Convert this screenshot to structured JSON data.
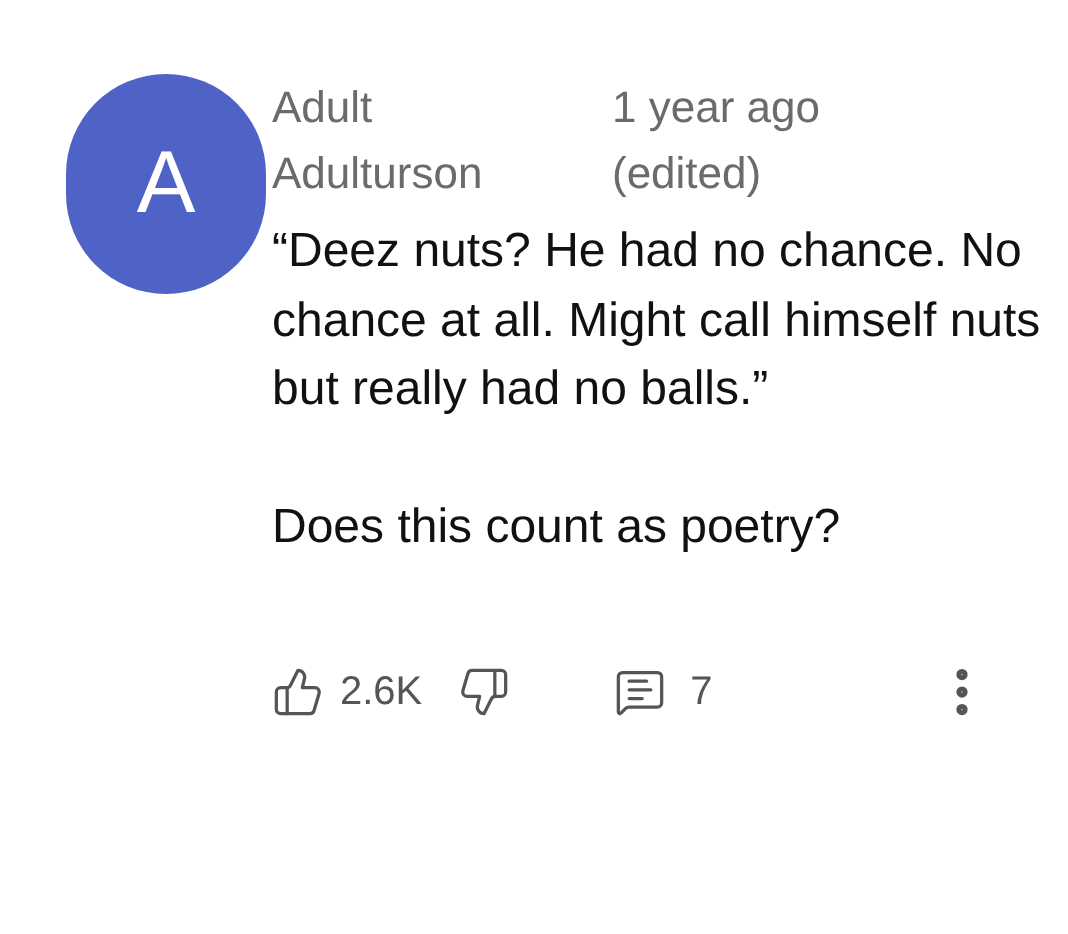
{
  "comment": {
    "avatar_letter": "A",
    "author": "Adult Adulturson",
    "time": "1 year ago (edited)",
    "paragraphs": [
      "“Deez nuts? He had no chance. No chance at all. Might call himself nuts but really had no balls.”",
      "Does this count as poetry?"
    ],
    "likes": "2.6K",
    "replies": "7"
  }
}
